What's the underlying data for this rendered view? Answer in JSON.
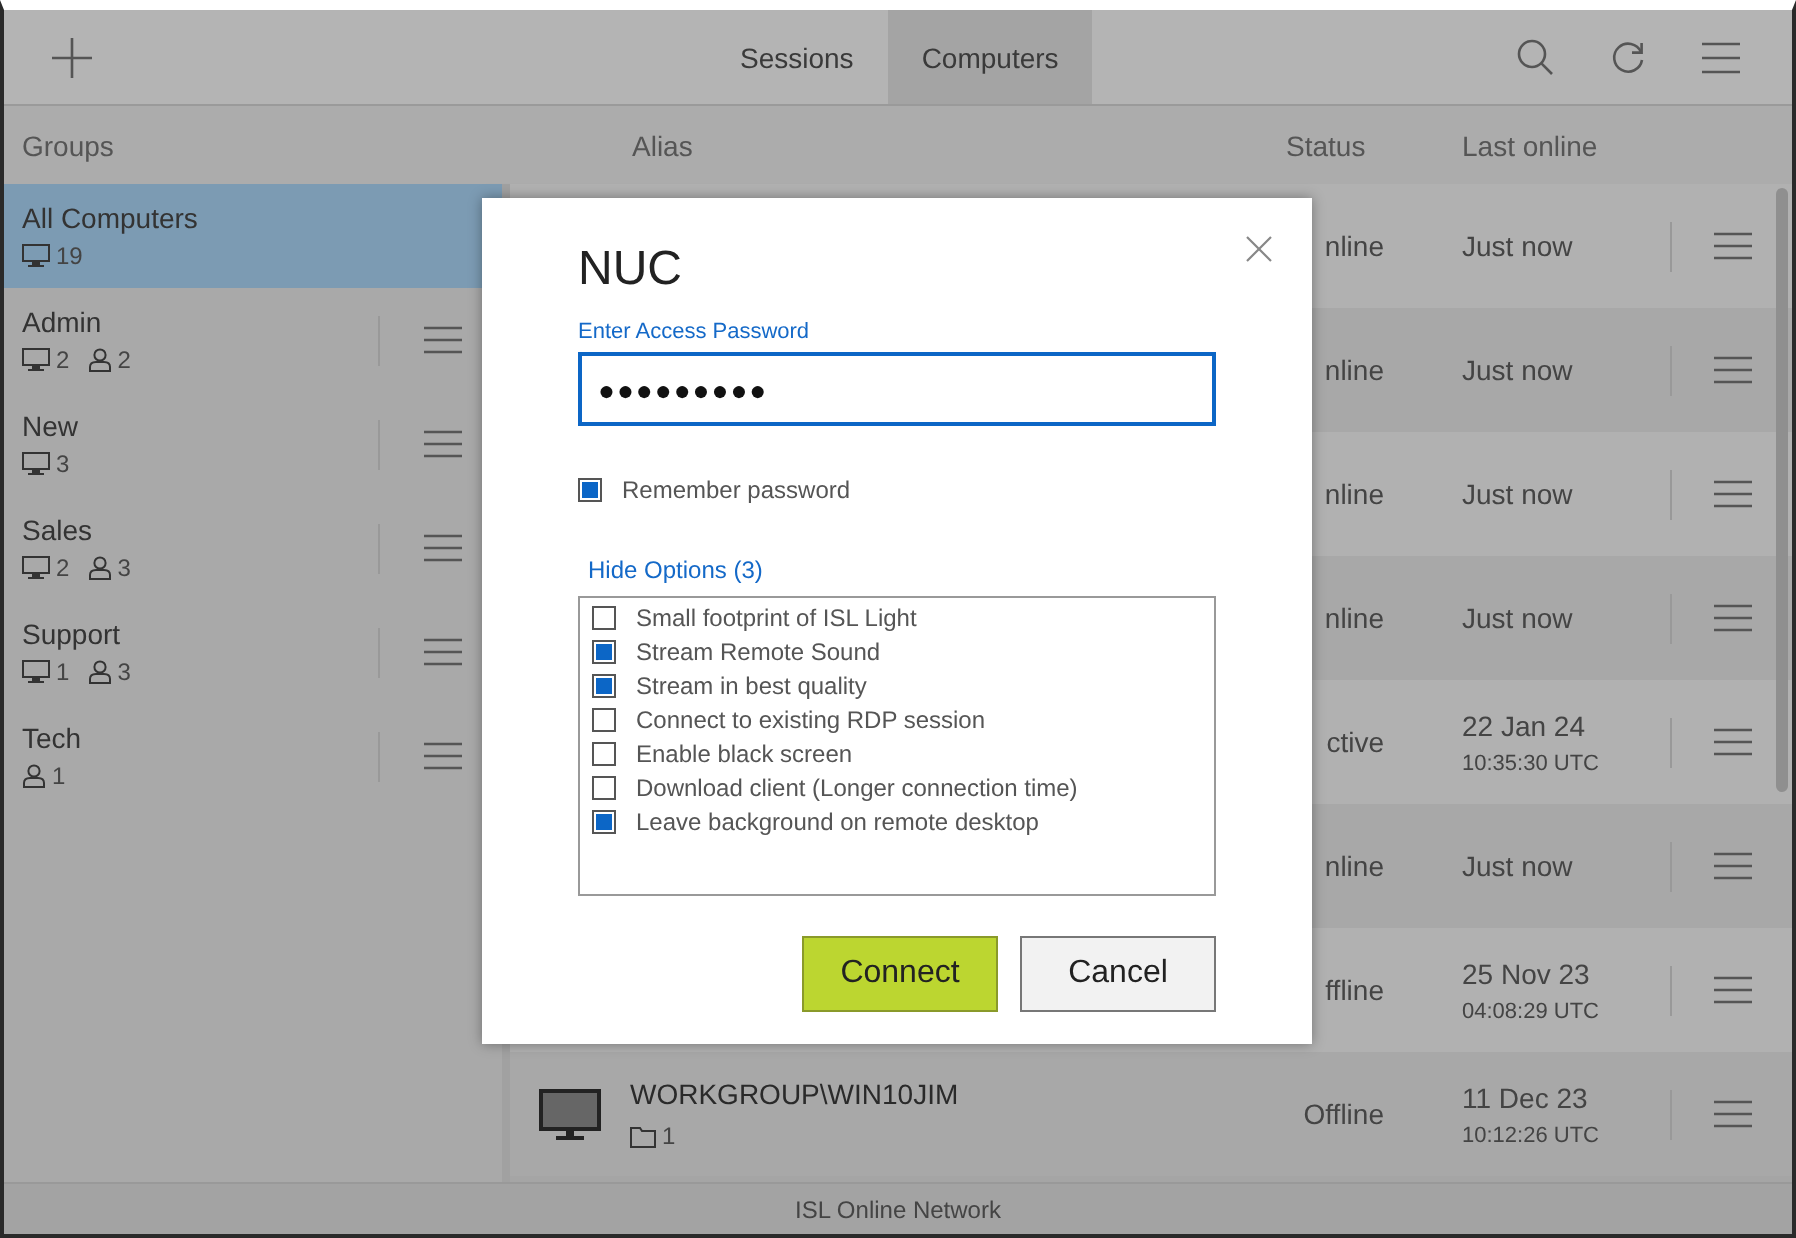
{
  "toolbar": {
    "tabs": [
      {
        "label": "Sessions",
        "selected": false
      },
      {
        "label": "Computers",
        "selected": true
      }
    ]
  },
  "groups_header": "Groups",
  "columns": {
    "alias": "Alias",
    "status": "Status",
    "last_online": "Last online"
  },
  "groups": [
    {
      "name": "All Computers",
      "computers": "19",
      "selected": true
    },
    {
      "name": "Admin",
      "computers": "2",
      "users": "2",
      "selected": false
    },
    {
      "name": "New",
      "computers": "3",
      "selected": false
    },
    {
      "name": "Sales",
      "computers": "2",
      "users": "3",
      "selected": false
    },
    {
      "name": "Support",
      "computers": "1",
      "users": "3",
      "selected": false
    },
    {
      "name": "Tech",
      "users": "1",
      "selected": false
    }
  ],
  "computers": [
    {
      "status": "nline",
      "last_online": "Just now"
    },
    {
      "status": "nline",
      "last_online": "Just now"
    },
    {
      "status": "nline",
      "last_online": "Just now"
    },
    {
      "status": "nline",
      "last_online": "Just now"
    },
    {
      "status": "ctive",
      "last_online": "22 Jan 24",
      "time": "10:35:30 UTC"
    },
    {
      "status": "nline",
      "last_online": "Just now"
    },
    {
      "status": "ffline",
      "last_online": "25 Nov 23",
      "time": "04:08:29 UTC"
    },
    {
      "alias": "WORKGROUP\\WIN10JIM",
      "folders": "1",
      "status": "Offline",
      "last_online": "11 Dec 23",
      "time": "10:12:26 UTC"
    }
  ],
  "status_bar": "ISL Online Network",
  "dialog": {
    "title": "NUC",
    "password_label": "Enter Access Password",
    "password_value": "●●●●●●●●●",
    "remember": {
      "label": "Remember password",
      "checked": true
    },
    "options_link": "Hide Options (3)",
    "options": [
      {
        "label": "Small footprint of ISL Light",
        "checked": false
      },
      {
        "label": "Stream Remote Sound",
        "checked": true
      },
      {
        "label": "Stream in best quality",
        "checked": true
      },
      {
        "label": "Connect to existing RDP session",
        "checked": false
      },
      {
        "label": "Enable black screen",
        "checked": false
      },
      {
        "label": "Download client (Longer connection time)",
        "checked": false
      },
      {
        "label": "Leave background on remote desktop",
        "checked": true
      }
    ],
    "buttons": [
      {
        "label": "Connect",
        "kind": "primary"
      },
      {
        "label": "Cancel",
        "kind": "secondary"
      }
    ]
  }
}
